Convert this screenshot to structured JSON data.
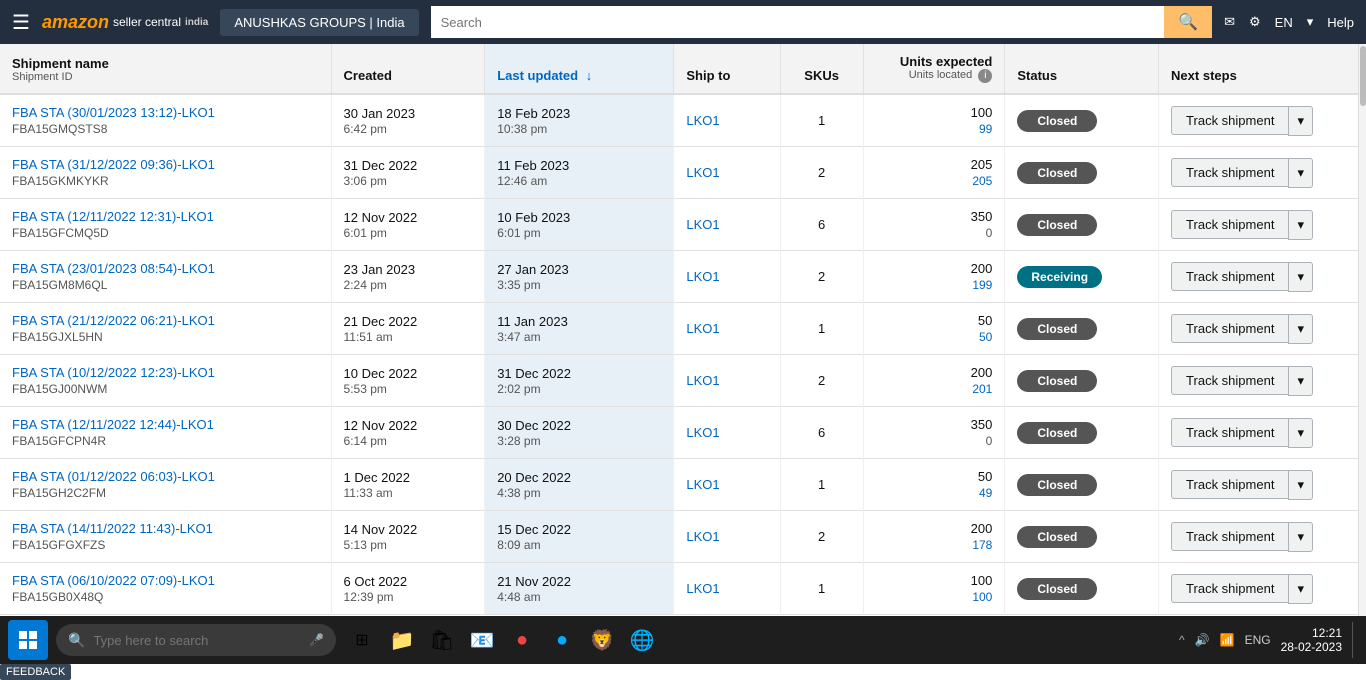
{
  "amazon_bar": {
    "logo": "amazon",
    "seller_central_label": "seller central",
    "india_label": "india",
    "seller_name": "ANUSHKAS GROUPS | India",
    "search_placeholder": "Search",
    "feedback_label": "FEEDBACK",
    "lang": "EN",
    "help": "Help"
  },
  "table": {
    "columns": [
      {
        "id": "name",
        "label": "Shipment name",
        "sub_label": "Shipment ID",
        "sortable": false
      },
      {
        "id": "created",
        "label": "Created",
        "sub_label": "",
        "sortable": false
      },
      {
        "id": "updated",
        "label": "Last updated",
        "sub_label": "",
        "sortable": true,
        "sort_dir": "desc"
      },
      {
        "id": "shipto",
        "label": "Ship to",
        "sub_label": "",
        "sortable": false
      },
      {
        "id": "skus",
        "label": "SKUs",
        "sub_label": "",
        "sortable": false
      },
      {
        "id": "units",
        "label": "Units expected",
        "sub_label": "Units located",
        "sortable": false
      },
      {
        "id": "status",
        "label": "Status",
        "sub_label": "",
        "sortable": false
      },
      {
        "id": "nextsteps",
        "label": "Next steps",
        "sub_label": "",
        "sortable": false
      }
    ],
    "rows": [
      {
        "name": "FBA STA (30/01/2023 13:12)-LKO1",
        "id": "FBA15GMQSTS8",
        "created_date": "30 Jan 2023",
        "created_time": "6:42 pm",
        "updated_date": "18 Feb 2023",
        "updated_time": "10:38 pm",
        "ship_to": "LKO1",
        "skus": "1",
        "units_expected": "100",
        "units_located": "99",
        "status": "Closed",
        "status_type": "closed"
      },
      {
        "name": "FBA STA (31/12/2022 09:36)-LKO1",
        "id": "FBA15GKMKYKR",
        "created_date": "31 Dec 2022",
        "created_time": "3:06 pm",
        "updated_date": "11 Feb 2023",
        "updated_time": "12:46 am",
        "ship_to": "LKO1",
        "skus": "2",
        "units_expected": "205",
        "units_located": "205",
        "status": "Closed",
        "status_type": "closed"
      },
      {
        "name": "FBA STA (12/11/2022 12:31)-LKO1",
        "id": "FBA15GFCMQ5D",
        "created_date": "12 Nov 2022",
        "created_time": "6:01 pm",
        "updated_date": "10 Feb 2023",
        "updated_time": "6:01 pm",
        "ship_to": "LKO1",
        "skus": "6",
        "units_expected": "350",
        "units_located": "0",
        "status": "Closed",
        "status_type": "closed"
      },
      {
        "name": "FBA STA (23/01/2023 08:54)-LKO1",
        "id": "FBA15GM8M6QL",
        "created_date": "23 Jan 2023",
        "created_time": "2:24 pm",
        "updated_date": "27 Jan 2023",
        "updated_time": "3:35 pm",
        "ship_to": "LKO1",
        "skus": "2",
        "units_expected": "200",
        "units_located": "199",
        "status": "Receiving",
        "status_type": "receiving"
      },
      {
        "name": "FBA STA (21/12/2022 06:21)-LKO1",
        "id": "FBA15GJXL5HN",
        "created_date": "21 Dec 2022",
        "created_time": "11:51 am",
        "updated_date": "11 Jan 2023",
        "updated_time": "3:47 am",
        "ship_to": "LKO1",
        "skus": "1",
        "units_expected": "50",
        "units_located": "50",
        "status": "Closed",
        "status_type": "closed"
      },
      {
        "name": "FBA STA (10/12/2022 12:23)-LKO1",
        "id": "FBA15GJ00NWM",
        "created_date": "10 Dec 2022",
        "created_time": "5:53 pm",
        "updated_date": "31 Dec 2022",
        "updated_time": "2:02 pm",
        "ship_to": "LKO1",
        "skus": "2",
        "units_expected": "200",
        "units_located": "201",
        "status": "Closed",
        "status_type": "closed"
      },
      {
        "name": "FBA STA (12/11/2022 12:44)-LKO1",
        "id": "FBA15GFCPN4R",
        "created_date": "12 Nov 2022",
        "created_time": "6:14 pm",
        "updated_date": "30 Dec 2022",
        "updated_time": "3:28 pm",
        "ship_to": "LKO1",
        "skus": "6",
        "units_expected": "350",
        "units_located": "0",
        "status": "Closed",
        "status_type": "closed"
      },
      {
        "name": "FBA STA (01/12/2022 06:03)-LKO1",
        "id": "FBA15GH2C2FM",
        "created_date": "1 Dec 2022",
        "created_time": "11:33 am",
        "updated_date": "20 Dec 2022",
        "updated_time": "4:38 pm",
        "ship_to": "LKO1",
        "skus": "1",
        "units_expected": "50",
        "units_located": "49",
        "status": "Closed",
        "status_type": "closed"
      },
      {
        "name": "FBA STA (14/11/2022 11:43)-LKO1",
        "id": "FBA15GFGXFZS",
        "created_date": "14 Nov 2022",
        "created_time": "5:13 pm",
        "updated_date": "15 Dec 2022",
        "updated_time": "8:09 am",
        "ship_to": "LKO1",
        "skus": "2",
        "units_expected": "200",
        "units_located": "178",
        "status": "Closed",
        "status_type": "closed"
      },
      {
        "name": "FBA STA (06/10/2022 07:09)-LKO1",
        "id": "FBA15GB0X48Q",
        "created_date": "6 Oct 2022",
        "created_time": "12:39 pm",
        "updated_date": "21 Nov 2022",
        "updated_time": "4:48 am",
        "ship_to": "LKO1",
        "skus": "1",
        "units_expected": "100",
        "units_located": "100",
        "status": "Closed",
        "status_type": "closed"
      }
    ],
    "track_btn_label": "Track shipment"
  },
  "taskbar": {
    "search_placeholder": "Type here to search",
    "time": "12:21",
    "date": "28-02-2023",
    "language": "ENG"
  }
}
